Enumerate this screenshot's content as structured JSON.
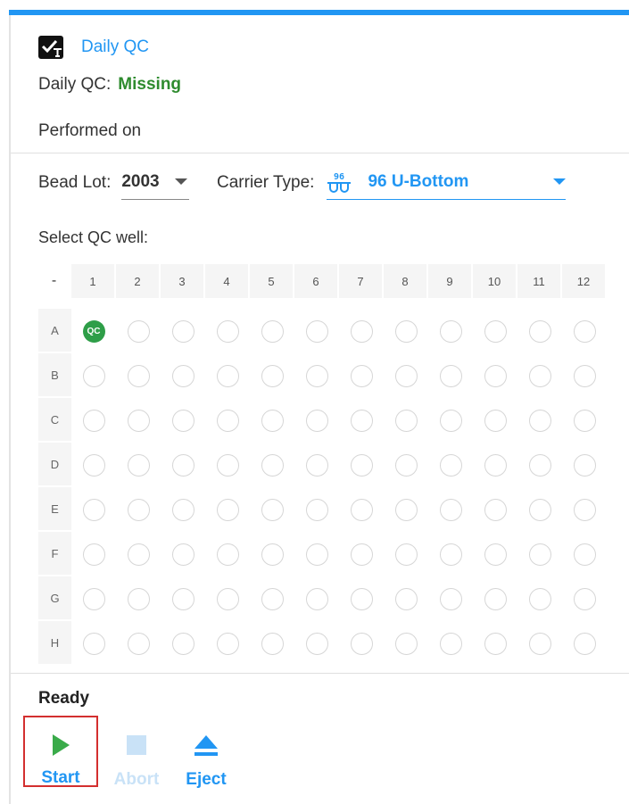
{
  "qc": {
    "title": "Daily QC",
    "status_label": "Daily QC:",
    "status_value": "Missing",
    "performed_label": "Performed on"
  },
  "bead_lot": {
    "label": "Bead Lot:",
    "value": "2003"
  },
  "carrier": {
    "label": "Carrier Type:",
    "icon_text": "96",
    "value": "96 U-Bottom"
  },
  "plate": {
    "label": "Select QC well:",
    "corner": "-",
    "columns": [
      "1",
      "2",
      "3",
      "4",
      "5",
      "6",
      "7",
      "8",
      "9",
      "10",
      "11",
      "12"
    ],
    "rows": [
      "A",
      "B",
      "C",
      "D",
      "E",
      "F",
      "G",
      "H"
    ],
    "qc_well": "A1",
    "qc_badge": "QC"
  },
  "status": {
    "text": "Ready"
  },
  "actions": {
    "start": "Start",
    "abort": "Abort",
    "eject": "Eject"
  },
  "colors": {
    "accent": "#2196f3",
    "success": "#2e8b2e",
    "qc_well": "#2e9e48",
    "highlight": "#d32f2f",
    "disabled": "#c9e2f7"
  }
}
